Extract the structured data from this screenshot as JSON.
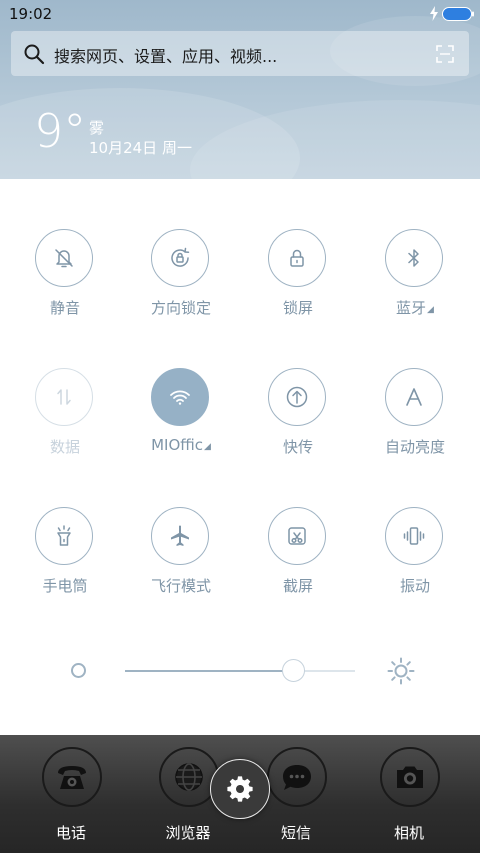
{
  "status_bar": {
    "time": "19:02"
  },
  "search": {
    "placeholder": "搜索网页、设置、应用、视频..."
  },
  "weather": {
    "temperature": "9°",
    "condition": "雾",
    "date": "10月24日 周一"
  },
  "toggles": [
    {
      "label": "静音",
      "icon": "bell-off-icon",
      "state": "off"
    },
    {
      "label": "方向锁定",
      "icon": "rotation-lock-icon",
      "state": "off"
    },
    {
      "label": "锁屏",
      "icon": "lock-icon",
      "state": "off"
    },
    {
      "label": "蓝牙",
      "icon": "bluetooth-icon",
      "state": "off",
      "has_more": true
    },
    {
      "label": "数据",
      "icon": "mobile-data-icon",
      "state": "disabled"
    },
    {
      "label": "MIOffic",
      "icon": "wifi-icon",
      "state": "on",
      "has_more": true
    },
    {
      "label": "快传",
      "icon": "quick-transfer-icon",
      "state": "off"
    },
    {
      "label": "自动亮度",
      "icon": "auto-brightness-icon",
      "state": "off"
    },
    {
      "label": "手电筒",
      "icon": "flashlight-icon",
      "state": "off"
    },
    {
      "label": "飞行模式",
      "icon": "airplane-icon",
      "state": "off"
    },
    {
      "label": "截屏",
      "icon": "screenshot-icon",
      "state": "off"
    },
    {
      "label": "振动",
      "icon": "vibrate-icon",
      "state": "off"
    }
  ],
  "brightness": {
    "level": 0.73
  },
  "dock": [
    {
      "label": "电话",
      "icon": "phone-icon"
    },
    {
      "label": "浏览器",
      "icon": "browser-icon"
    },
    {
      "label": "短信",
      "icon": "message-icon"
    },
    {
      "label": "相机",
      "icon": "camera-icon"
    }
  ],
  "colors": {
    "accent": "#96b1c6",
    "icon_stroke": "#7f95a7",
    "label": "#7f95a7",
    "dock_bg": "#2e2e2e"
  }
}
